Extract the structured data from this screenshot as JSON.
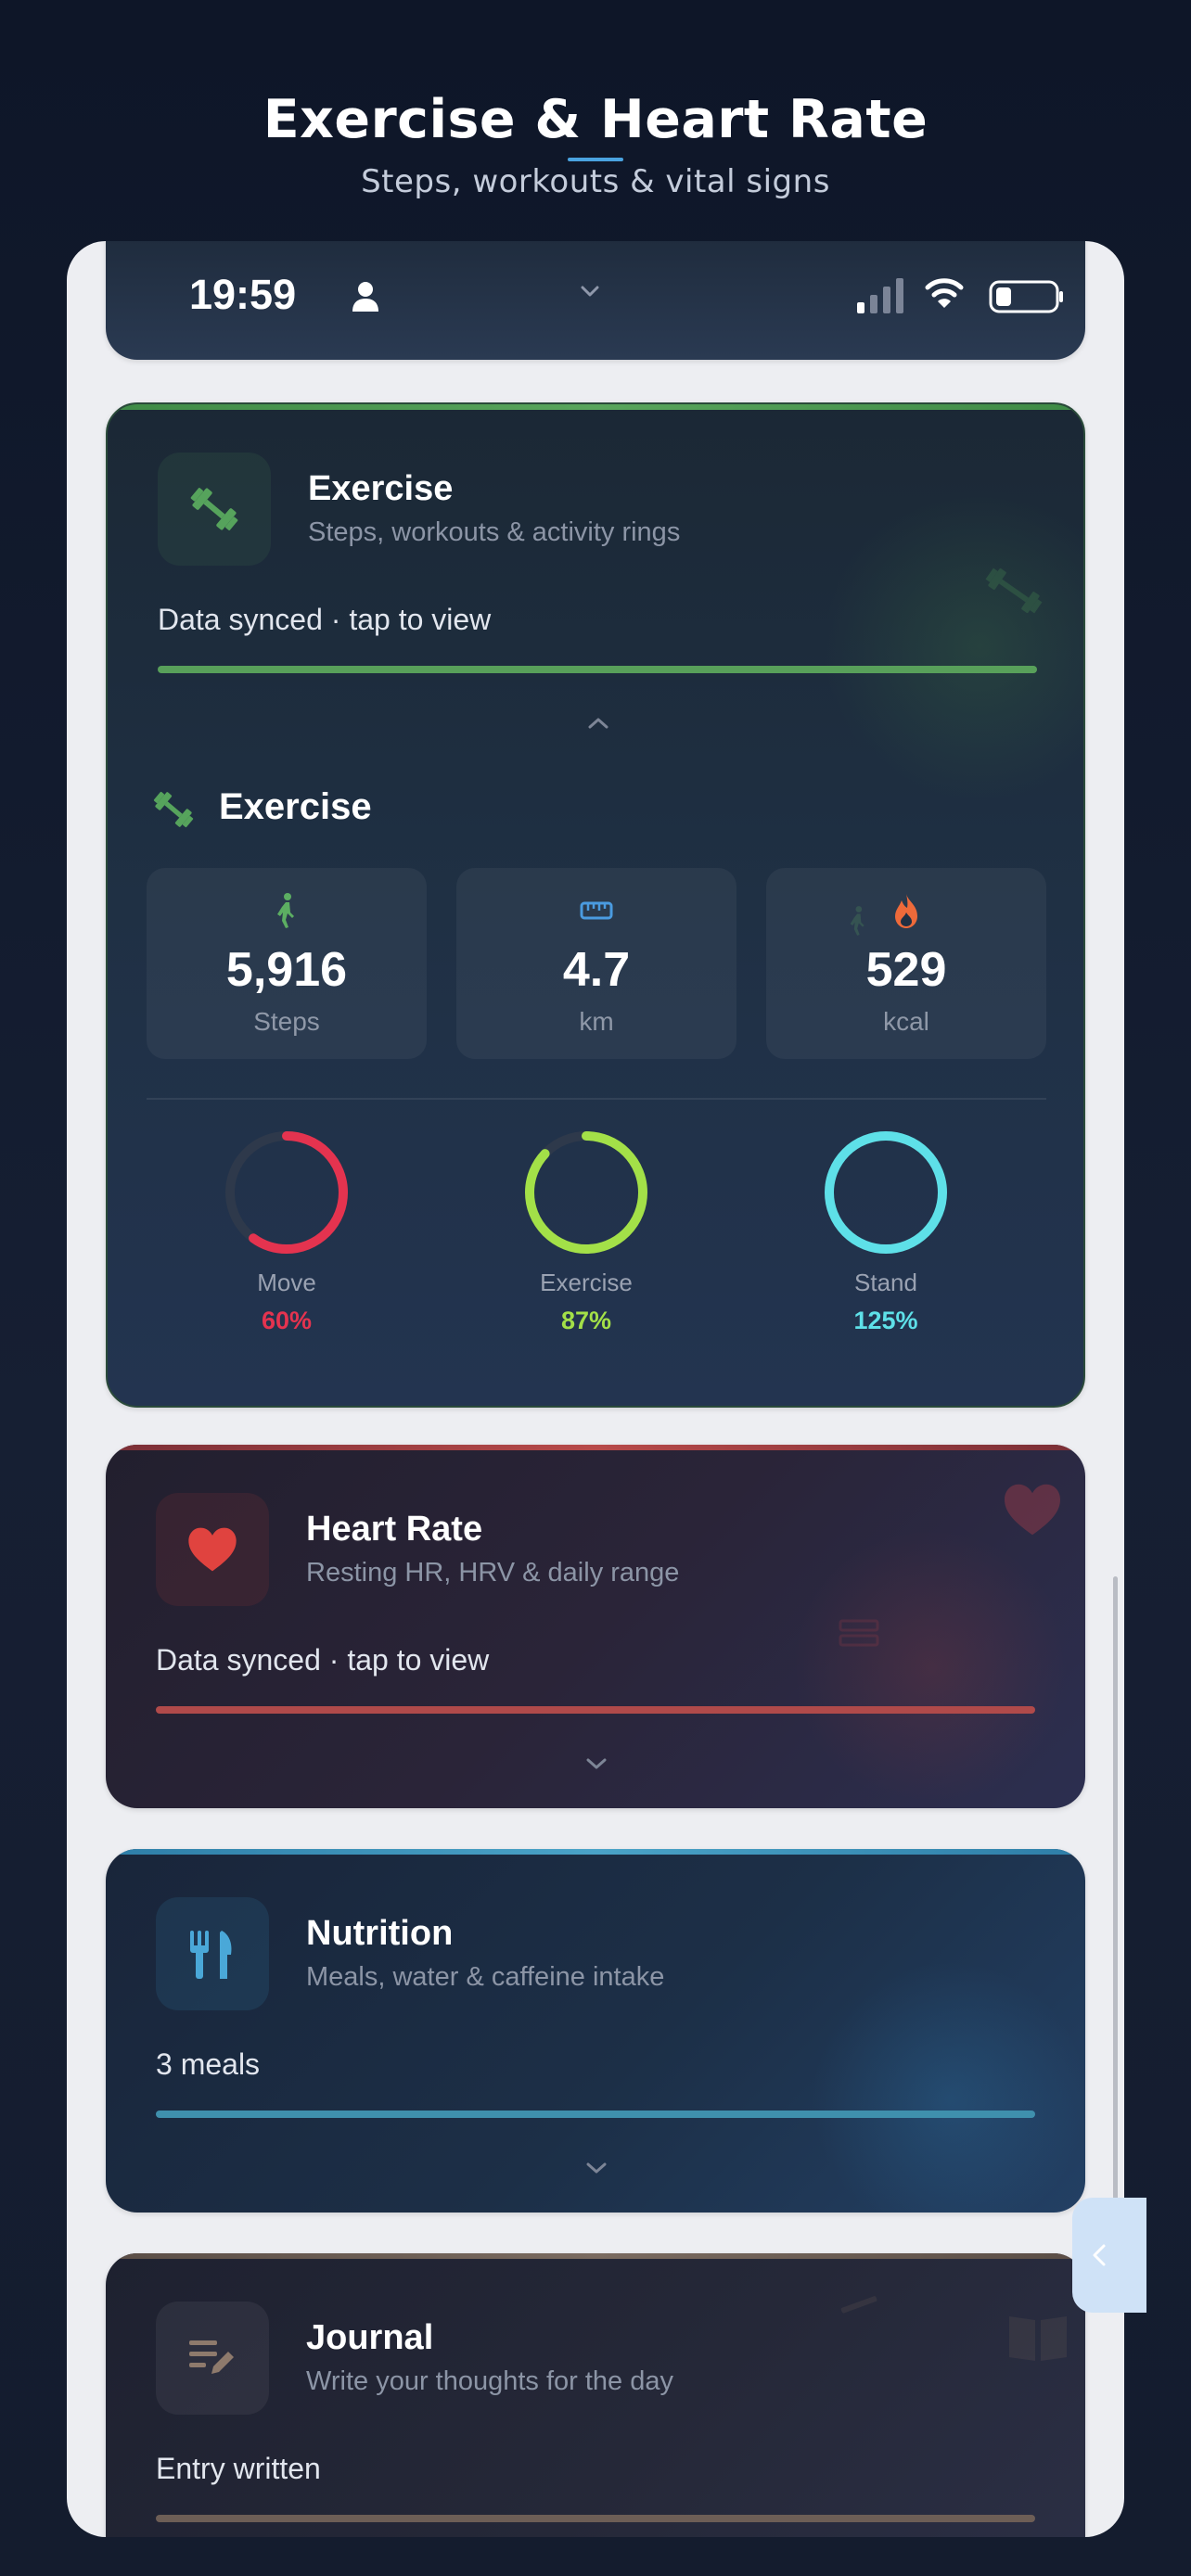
{
  "header": {
    "title": "Exercise & Heart Rate",
    "subtitle": "Steps, workouts & vital signs"
  },
  "status_bar": {
    "time": "19:59"
  },
  "exercise_card": {
    "title": "Exercise",
    "subtitle": "Steps, workouts & activity rings",
    "status": "Data synced · tap to view",
    "section_title": "Exercise",
    "stats": [
      {
        "icon": "walking-icon",
        "value": "5,916",
        "unit": "Steps"
      },
      {
        "icon": "ruler-icon",
        "value": "4.7",
        "unit": "km"
      },
      {
        "icon": "flame-icon",
        "value": "529",
        "unit": "kcal"
      }
    ],
    "rings": [
      {
        "label": "Move",
        "percent_text": "60%",
        "fraction": 0.6,
        "color": "#e4334f"
      },
      {
        "label": "Exercise",
        "percent_text": "87%",
        "fraction": 0.87,
        "color": "#a3e048"
      },
      {
        "label": "Stand",
        "percent_text": "125%",
        "fraction": 1.25,
        "color": "#5ee0e8"
      }
    ],
    "accent_color": "#4f9a57"
  },
  "heart_card": {
    "title": "Heart Rate",
    "subtitle": "Resting HR, HRV & daily range",
    "status": "Data synced · tap to view",
    "accent_color": "#b04a4a"
  },
  "nutrition_card": {
    "title": "Nutrition",
    "subtitle": "Meals, water & caffeine intake",
    "status": "3 meals",
    "accent_color": "#4aa3c8"
  },
  "journal_card": {
    "title": "Journal",
    "subtitle": "Write your thoughts for the day",
    "status": "Entry written",
    "accent_color": "#7a6a60"
  }
}
